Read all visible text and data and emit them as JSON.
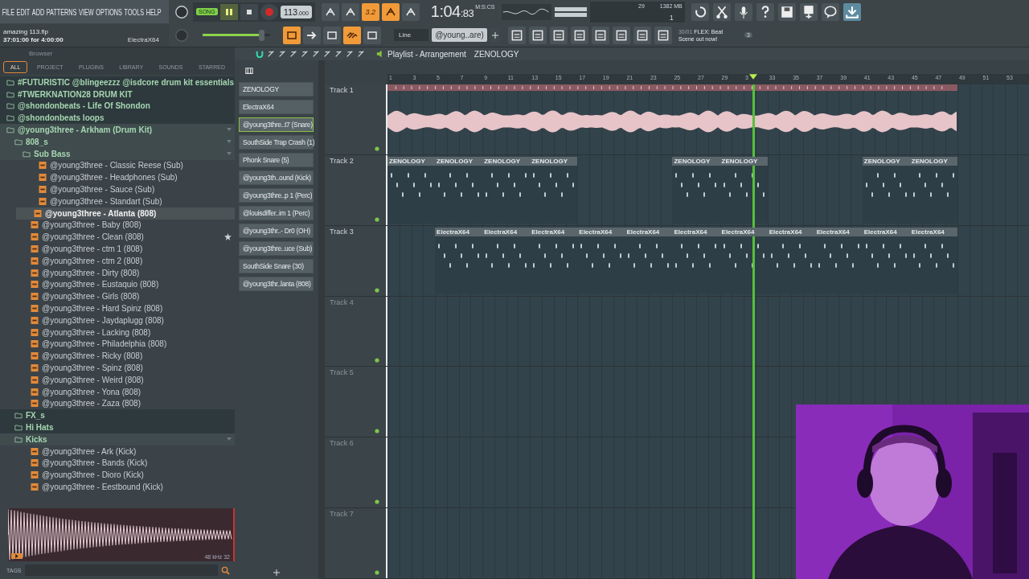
{
  "menu": [
    "FILE",
    "EDIT",
    "ADD",
    "PATTERNS",
    "VIEW",
    "OPTIONS",
    "TOOLS",
    "HELP"
  ],
  "hint": {
    "file": "amazing 113.flp",
    "time": "37:01:00 for 4:00:00",
    "channel": "ElectraX64"
  },
  "transport": {
    "mode": "SONG",
    "playing": true,
    "recording": false,
    "tempo": "113",
    "tempo_fraction": ".000"
  },
  "tool_buttons": [
    {
      "on": false
    },
    {
      "on": false
    },
    {
      "label": "3.2",
      "on": true
    },
    {
      "on": true
    },
    {
      "on": false
    }
  ],
  "master_volume": {
    "level": 0.88
  },
  "tool_buttons_2": [
    {
      "on": true
    },
    {
      "on": false
    },
    {
      "on": false
    },
    {
      "on": true
    },
    {
      "on": false
    }
  ],
  "time": {
    "value": "1:04",
    "centis": ":83",
    "unit": "M:S:CS"
  },
  "cpu": {
    "value": "29",
    "memory": "1382 MB",
    "voices": "1"
  },
  "snap": "Line",
  "pattern": "@young..are)",
  "news": {
    "date": "30/01",
    "text": "FLEX: Beat Scene out now!",
    "count": "3"
  },
  "browser": {
    "title": "Browser",
    "tabs": [
      {
        "label": "ALL",
        "selected": true
      },
      {
        "label": "PROJECT",
        "selected": false
      },
      {
        "label": "PLUGINS",
        "selected": false
      },
      {
        "label": "LIBRARY",
        "selected": false
      },
      {
        "label": "SOUNDS",
        "selected": false
      },
      {
        "label": "STARRED",
        "selected": false
      }
    ],
    "tree": [
      {
        "kind": "folder",
        "name": "#FUTURISTIC @blingeezzz @isdcore drum kit essentials",
        "expanded": false
      },
      {
        "kind": "folder",
        "name": "#TWERKNATION28 DRUM KIT",
        "expanded": false
      },
      {
        "kind": "folder",
        "name": "@shondonbeats - Life Of Shondon",
        "expanded": false
      },
      {
        "kind": "folder",
        "name": "@shondonbeats loops",
        "expanded": false
      },
      {
        "kind": "folder",
        "name": "@young3three - Arkham (Drum Kit)",
        "expanded": true,
        "children": [
          {
            "kind": "folder",
            "name": "808_s",
            "expanded": true,
            "children": [
              {
                "kind": "folder",
                "name": "Sub Bass",
                "expanded": true,
                "children": [
                  {
                    "kind": "file",
                    "name": "@young3three - Classic Reese (Sub)",
                    "selected": false,
                    "starred": false
                  },
                  {
                    "kind": "file",
                    "name": "@young3three - Headphones (Sub)",
                    "selected": false,
                    "starred": false
                  },
                  {
                    "kind": "file",
                    "name": "@young3three - Sauce (Sub)",
                    "selected": false,
                    "starred": false
                  },
                  {
                    "kind": "file",
                    "name": "@young3three - Standart (Sub)",
                    "selected": false,
                    "starred": false
                  }
                ]
              },
              {
                "kind": "file",
                "name": "@young3three - Atlanta (808)",
                "selected": true,
                "starred": false
              },
              {
                "kind": "file",
                "name": "@young3three - Baby (808)",
                "selected": false,
                "starred": false
              },
              {
                "kind": "file",
                "name": "@young3three - Clean (808)",
                "selected": false,
                "starred": true
              },
              {
                "kind": "file",
                "name": "@young3three - ctm 1 (808)",
                "selected": false,
                "starred": false
              },
              {
                "kind": "file",
                "name": "@young3three - ctm 2 (808)",
                "selected": false,
                "starred": false
              },
              {
                "kind": "file",
                "name": "@young3three - Dirty (808)",
                "selected": false,
                "starred": false
              },
              {
                "kind": "file",
                "name": "@young3three - Eustaquio (808)",
                "selected": false,
                "starred": false
              },
              {
                "kind": "file",
                "name": "@young3three - Girls (808)",
                "selected": false,
                "starred": false
              },
              {
                "kind": "file",
                "name": "@young3three - Hard Spinz (808)",
                "selected": false,
                "starred": false
              },
              {
                "kind": "file",
                "name": "@young3three - Jaydaplugg (808)",
                "selected": false,
                "starred": false
              },
              {
                "kind": "file",
                "name": "@young3three - Lacking (808)",
                "selected": false,
                "starred": false
              },
              {
                "kind": "file",
                "name": "@young3three - Philadelphia (808)",
                "selected": false,
                "starred": false
              },
              {
                "kind": "file",
                "name": "@young3three - Ricky (808)",
                "selected": false,
                "starred": false
              },
              {
                "kind": "file",
                "name": "@young3three - Spinz (808)",
                "selected": false,
                "starred": false
              },
              {
                "kind": "file",
                "name": "@young3three - Weird (808)",
                "selected": false,
                "starred": false
              },
              {
                "kind": "file",
                "name": "@young3three - Yona (808)",
                "selected": false,
                "starred": false
              },
              {
                "kind": "file",
                "name": "@young3three - Zaza (808)",
                "selected": false,
                "starred": false
              }
            ]
          },
          {
            "kind": "folder",
            "name": "FX_s",
            "expanded": false
          },
          {
            "kind": "folder",
            "name": "Hi Hats",
            "expanded": false
          },
          {
            "kind": "folder",
            "name": "Kicks",
            "expanded": true,
            "children": [
              {
                "kind": "file",
                "name": "@young3three - Ark (Kick)",
                "selected": false,
                "starred": false
              },
              {
                "kind": "file",
                "name": "@young3three - Bands (Kick)",
                "selected": false,
                "starred": false
              },
              {
                "kind": "file",
                "name": "@young3three - Dioro (Kick)",
                "selected": false,
                "starred": false
              },
              {
                "kind": "file",
                "name": "@young3three - Eestbound (Kick)",
                "selected": false,
                "starred": false
              }
            ]
          }
        ]
      }
    ],
    "sample_info": "48 kHz 32",
    "tags_label": "TAGS"
  },
  "channels": [
    {
      "name": "ZENOLOGY",
      "selected": false
    },
    {
      "name": "ElectraX64",
      "selected": false
    },
    {
      "name": "@young3thre..t7 (Snare)",
      "selected": true
    },
    {
      "name": "SouthSide Trap Crash (1)",
      "selected": false
    },
    {
      "name": "Phonk Snare (5)",
      "selected": false
    },
    {
      "name": "@young3th..ound (Kick)",
      "selected": false
    },
    {
      "name": "@young3thre..p 1 (Perc)",
      "selected": false
    },
    {
      "name": "@louisdiffer..im 1 (Perc)",
      "selected": false
    },
    {
      "name": "@young3thr..- Dr0 (OH)",
      "selected": false
    },
    {
      "name": "@young3thre..uce (Sub)",
      "selected": false
    },
    {
      "name": "SouthSide Snare (30)",
      "selected": false
    },
    {
      "name": "@young3thr..lanta (808)",
      "selected": false
    }
  ],
  "playlist": {
    "title": "Playlist - Arrangement",
    "pattern": "ZENOLOGY",
    "ruler": [
      "1",
      "3",
      "5",
      "7",
      "9",
      "11",
      "13",
      "15",
      "17",
      "19",
      "21",
      "23",
      "25",
      "27",
      "29",
      "3",
      "33",
      "35",
      "37",
      "39",
      "41",
      "43",
      "45",
      "47",
      "49",
      "51",
      "53"
    ],
    "playhead": {
      "level": 0.567
    },
    "tracks": [
      {
        "name": "Track 1",
        "clips": [
          {
            "kind": "audio"
          }
        ]
      },
      {
        "name": "Track 2",
        "clips": [
          {
            "kind": "pattern",
            "name": "ZENOLOGY"
          },
          {
            "kind": "pattern",
            "name": "ZENOLOGY"
          },
          {
            "kind": "pattern",
            "name": "ZENOLOGY"
          },
          {
            "kind": "pattern",
            "name": "ZENOLOGY"
          },
          {
            "kind": "gap"
          },
          {
            "kind": "gap"
          },
          {
            "kind": "pattern",
            "name": "ZENOLOGY"
          },
          {
            "kind": "pattern",
            "name": "ZENOLOGY"
          },
          {
            "kind": "gap"
          },
          {
            "kind": "gap"
          },
          {
            "kind": "pattern",
            "name": "ZENOLOGY"
          },
          {
            "kind": "pattern",
            "name": "ZENOLOGY"
          }
        ]
      },
      {
        "name": "Track 3",
        "clips": [
          {
            "kind": "gap"
          },
          {
            "kind": "pattern",
            "name": "ElectraX64"
          },
          {
            "kind": "pattern",
            "name": "ElectraX64"
          },
          {
            "kind": "pattern",
            "name": "ElectraX64"
          },
          {
            "kind": "pattern",
            "name": "ElectraX64"
          },
          {
            "kind": "pattern",
            "name": "ElectraX64"
          },
          {
            "kind": "pattern",
            "name": "ElectraX64"
          },
          {
            "kind": "pattern",
            "name": "ElectraX64"
          },
          {
            "kind": "pattern",
            "name": "ElectraX64"
          },
          {
            "kind": "pattern",
            "name": "ElectraX64"
          },
          {
            "kind": "pattern",
            "name": "ElectraX64"
          },
          {
            "kind": "pattern",
            "name": "ElectraX64"
          }
        ]
      },
      {
        "name": "Track 4"
      },
      {
        "name": "Track 5"
      },
      {
        "name": "Track 6"
      },
      {
        "name": "Track 7"
      }
    ]
  }
}
